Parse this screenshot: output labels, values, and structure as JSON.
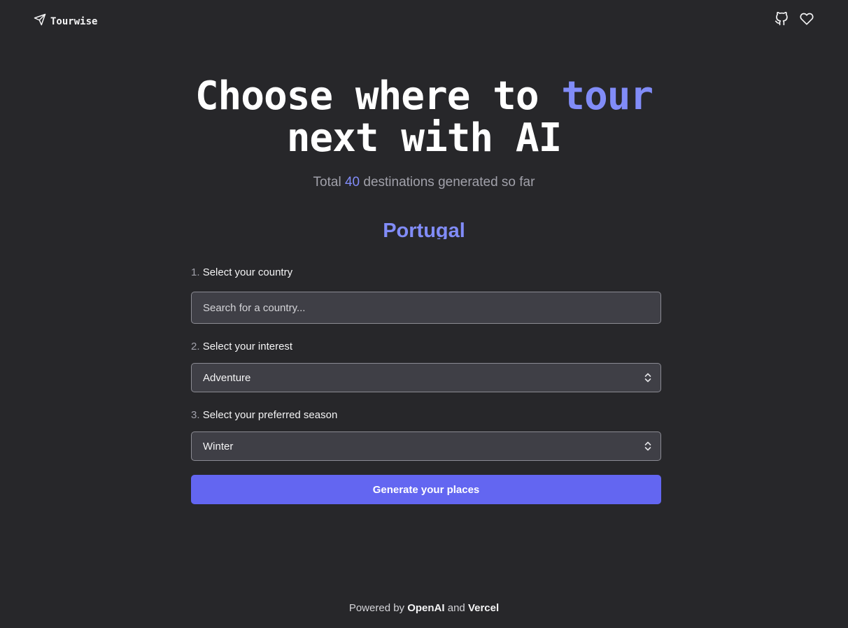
{
  "header": {
    "brand": "Tourwise",
    "icons": [
      "send-icon",
      "github-icon",
      "heart-icon"
    ]
  },
  "hero": {
    "title_part1": "Choose where to ",
    "title_accent": "tour",
    "title_part2": "next with AI",
    "subtitle_prefix": "Total ",
    "subtitle_count": "40",
    "subtitle_suffix": " destinations generated so far"
  },
  "country_title": "Portugal",
  "form": {
    "step1": {
      "num": "1.",
      "label": "Select your country",
      "placeholder": "Search for a country..."
    },
    "step2": {
      "num": "2.",
      "label": "Select your interest",
      "value": "Adventure"
    },
    "step3": {
      "num": "3.",
      "label": "Select your preferred season",
      "value": "Winter"
    },
    "submit_label": "Generate your places"
  },
  "footer": {
    "prefix": "Powered by ",
    "openai": "OpenAI",
    "and": " and ",
    "vercel": "Vercel"
  },
  "colors": {
    "background": "#27272a",
    "accent": "#818cf8",
    "button": "#6366f1",
    "field_bg": "#3f3f46"
  }
}
